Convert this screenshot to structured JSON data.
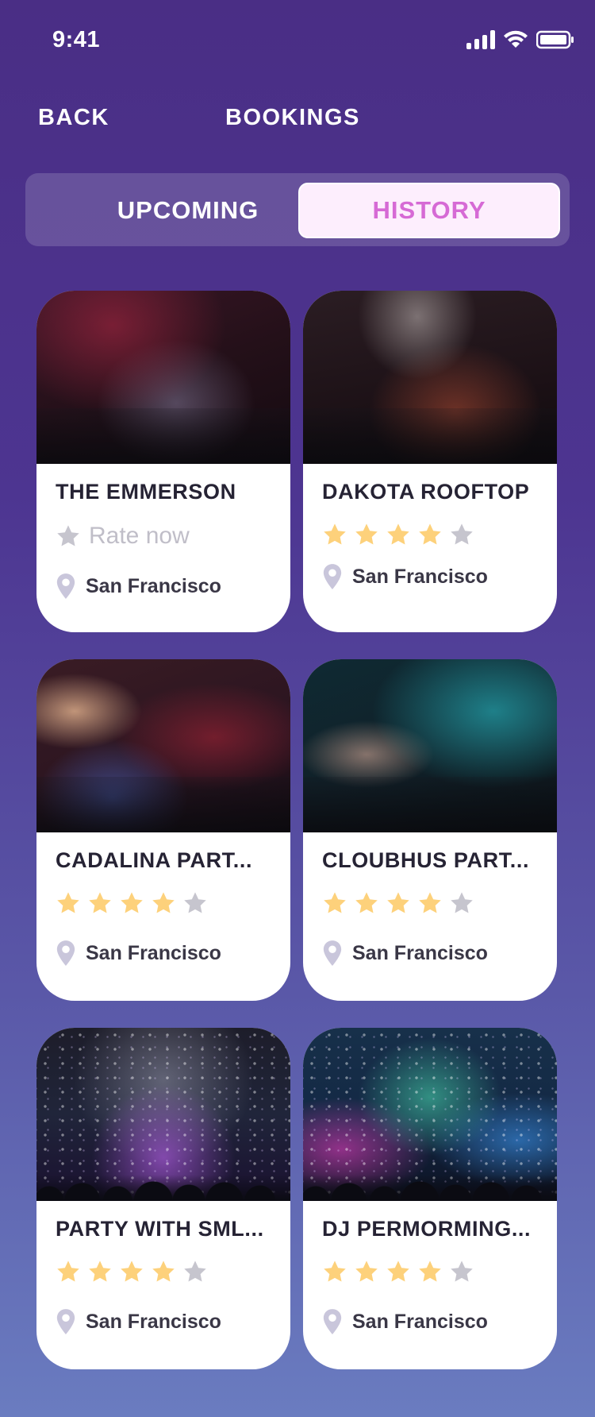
{
  "status_bar": {
    "time": "9:41"
  },
  "header": {
    "back_label": "BACK",
    "title": "BOOKINGS"
  },
  "tabs": [
    {
      "label": "UPCOMING",
      "active": false
    },
    {
      "label": "HISTORY",
      "active": true
    }
  ],
  "colors": {
    "star_filled": "#fdd17b",
    "star_empty": "#c6c5ce",
    "active_tab_text": "#d66ad5",
    "pin": "#c9c6db"
  },
  "bookings": [
    {
      "title": "THE EMMERSON",
      "rate_now_label": "Rate now",
      "rating": null,
      "location": "San Francisco"
    },
    {
      "title": "DAKOTA ROOFTOP",
      "rating": 4,
      "max_rating": 5,
      "location": "San Francisco"
    },
    {
      "title": "CADALINA PART...",
      "rating": 4,
      "max_rating": 5,
      "location": "San Francisco"
    },
    {
      "title": "CLOUBHUS PART...",
      "rating": 4,
      "max_rating": 5,
      "location": "San Francisco"
    },
    {
      "title": "PARTY WITH SML...",
      "rating": 4,
      "max_rating": 5,
      "location": "San Francisco"
    },
    {
      "title": "DJ PERMORMING...",
      "rating": 4,
      "max_rating": 5,
      "location": "San Francisco"
    }
  ]
}
